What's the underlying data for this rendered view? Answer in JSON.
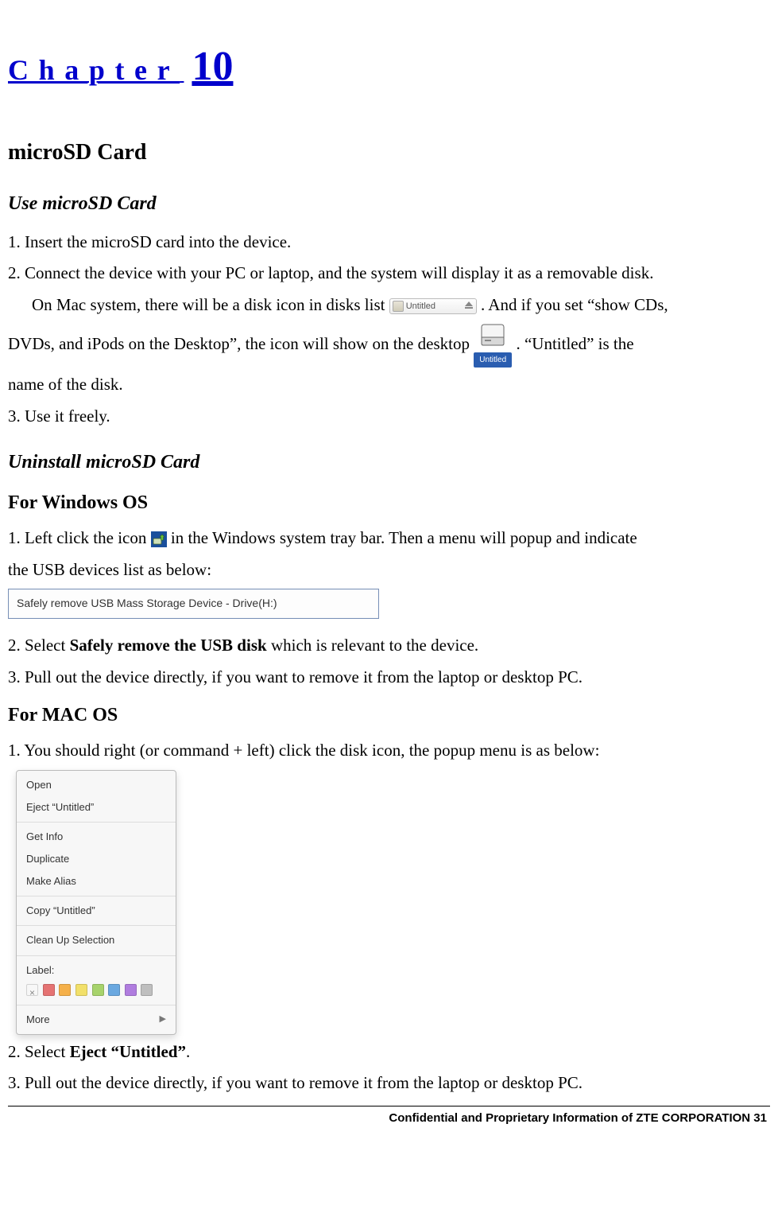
{
  "chapter": {
    "word": "Chapter",
    "number": "10"
  },
  "section_title": "microSD Card",
  "use": {
    "title": "Use microSD Card",
    "step1": "1. Insert the microSD card into the device.",
    "step2a": "2. Connect the device with your PC or laptop, and the system will display it as a removable disk.",
    "step2b_prefix": "On Mac system, there will be a disk icon in disks list",
    "step2b_suffix": ". And if you set “show CDs,",
    "step2c_prefix": "DVDs, and iPods on the Desktop”, the icon will show on the desktop",
    "step2c_suffix": ". “Untitled” is the",
    "step2d": "name of the disk.",
    "step3": "3. Use it freely.",
    "disk_list_label": "Untitled",
    "desktop_disk_label": "Untitled"
  },
  "uninstall": {
    "title": "Uninstall microSD Card",
    "windows": {
      "title": "For Windows OS",
      "step1_prefix": "1. Left click the icon ",
      "step1_suffix": " in the Windows system tray bar. Then a menu will popup and indicate",
      "step1_line2": "the USB devices list as below:",
      "menu_item": "Safely remove USB Mass Storage Device - Drive(H:)",
      "step2_prefix": "2.   Select ",
      "step2_bold": "Safely remove the USB disk",
      "step2_suffix": " which is relevant to the device.",
      "step3": "3. Pull out the device directly, if you want to remove it from the laptop or desktop PC."
    },
    "mac": {
      "title": "For MAC OS",
      "step1": "1.   You should right (or command + left) click the disk icon, the popup menu is as below:",
      "menu": {
        "open": "Open",
        "eject": "Eject “Untitled”",
        "getinfo": "Get Info",
        "duplicate": "Duplicate",
        "makealias": "Make Alias",
        "copy": "Copy “Untitled”",
        "cleanup": "Clean Up Selection",
        "label": "Label:",
        "more": "More",
        "swatch_colors": [
          "#e57373",
          "#f5b04a",
          "#f2e06a",
          "#a7d36c",
          "#6aa8e0",
          "#b07ddf",
          "#bfbfbf"
        ]
      },
      "step2_prefix": "2. Select ",
      "step2_bold": "Eject “Untitled”",
      "step2_suffix": ".",
      "step3": "3. Pull out the device directly, if you want to remove it from the laptop or desktop PC."
    }
  },
  "footer": "Confidential and Proprietary Information of ZTE CORPORATION 31"
}
